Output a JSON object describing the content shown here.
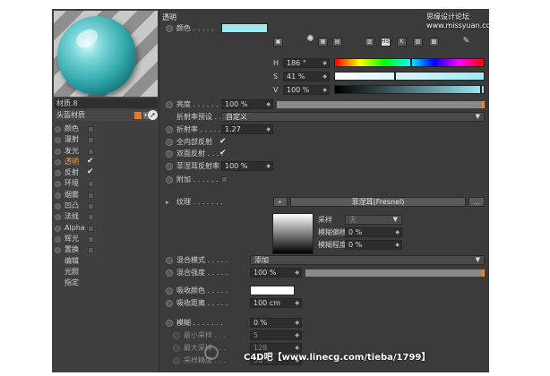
{
  "preview": {
    "material_name": "材质.8",
    "header_label": "头盔材质"
  },
  "channels": [
    {
      "label": "颜色",
      "checked": false,
      "active": false
    },
    {
      "label": "漫射",
      "checked": false,
      "active": false
    },
    {
      "label": "发光",
      "checked": false,
      "active": false
    },
    {
      "label": "透明",
      "checked": true,
      "active": true
    },
    {
      "label": "反射",
      "checked": true,
      "active": false
    },
    {
      "label": "环境",
      "checked": false,
      "active": false
    },
    {
      "label": "烟雾",
      "checked": false,
      "active": false
    },
    {
      "label": "凹凸",
      "checked": false,
      "active": false
    },
    {
      "label": "法线",
      "checked": false,
      "active": false
    },
    {
      "label": "Alpha",
      "checked": false,
      "active": false
    },
    {
      "label": "辉光",
      "checked": false,
      "active": false
    },
    {
      "label": "置换",
      "checked": false,
      "active": false
    }
  ],
  "sub_items": [
    "编辑",
    "光照",
    "指定"
  ],
  "section_title": "透明",
  "watermark_top": "思缘设计论坛 www.missyuan.com",
  "color": {
    "label": "颜色 . . . . .",
    "swatch": "#9ee9f2",
    "h": {
      "label": "H",
      "value": "186 °",
      "pct": 0.52
    },
    "s": {
      "label": "S",
      "value": "41 %",
      "pct": 0.41
    },
    "v": {
      "label": "V",
      "value": "100 %",
      "pct": 1.0
    }
  },
  "props": {
    "brightness": {
      "label": "亮度 . . . . . . .",
      "value": "100 %"
    },
    "ior_preset": {
      "label": "折射率预设 . . .",
      "value": "自定义"
    },
    "ior": {
      "label": "折射率 . . . . . .",
      "value": "1.27"
    },
    "total_internal": {
      "label": "全内部反射",
      "checked": true
    },
    "double_sided": {
      "label": "双面反射 . . . .",
      "checked": true
    },
    "fresnel": {
      "label": "菲涅耳反射率",
      "value": "100 %"
    },
    "additive": {
      "label": "附加 . . . . . . ."
    },
    "texture": {
      "label": "纹理 . . . . . . .",
      "shader": "菲涅耳(Fresnel)",
      "more": "..."
    },
    "sampling": {
      "label": "采样",
      "value": "无"
    },
    "blur_offset": {
      "label": "模糊偏移",
      "value": "0 %"
    },
    "blur_scale": {
      "label": "模糊程度",
      "value": "0 %"
    },
    "mix_mode": {
      "label": "混合模式 . . . . .",
      "value": "添加"
    },
    "mix_strength": {
      "label": "混合强度 . . . . .",
      "value": "100 %"
    },
    "absorb_color": {
      "label": "吸收颜色 . . . . .",
      "swatch": "#ffffff"
    },
    "absorb_dist": {
      "label": "吸收距离 . . . . .",
      "value": "100 cm"
    },
    "blur": {
      "label": "模糊 . . . . . . .",
      "value": "0 %"
    },
    "min_samples": {
      "label": "最小采样 . . .",
      "value": "5"
    },
    "max_samples": {
      "label": "最大采样 . . .",
      "value": "128"
    },
    "accuracy": {
      "label": "采样精度 . . .",
      "value": "50 %"
    }
  },
  "watermark_bottom": "C4D吧【www.linecg.com/tieba/1799】",
  "colors": {
    "accent": "#e08a30",
    "swatch_cyan": "#9ee9f2",
    "panel": "#3b3b3b"
  }
}
